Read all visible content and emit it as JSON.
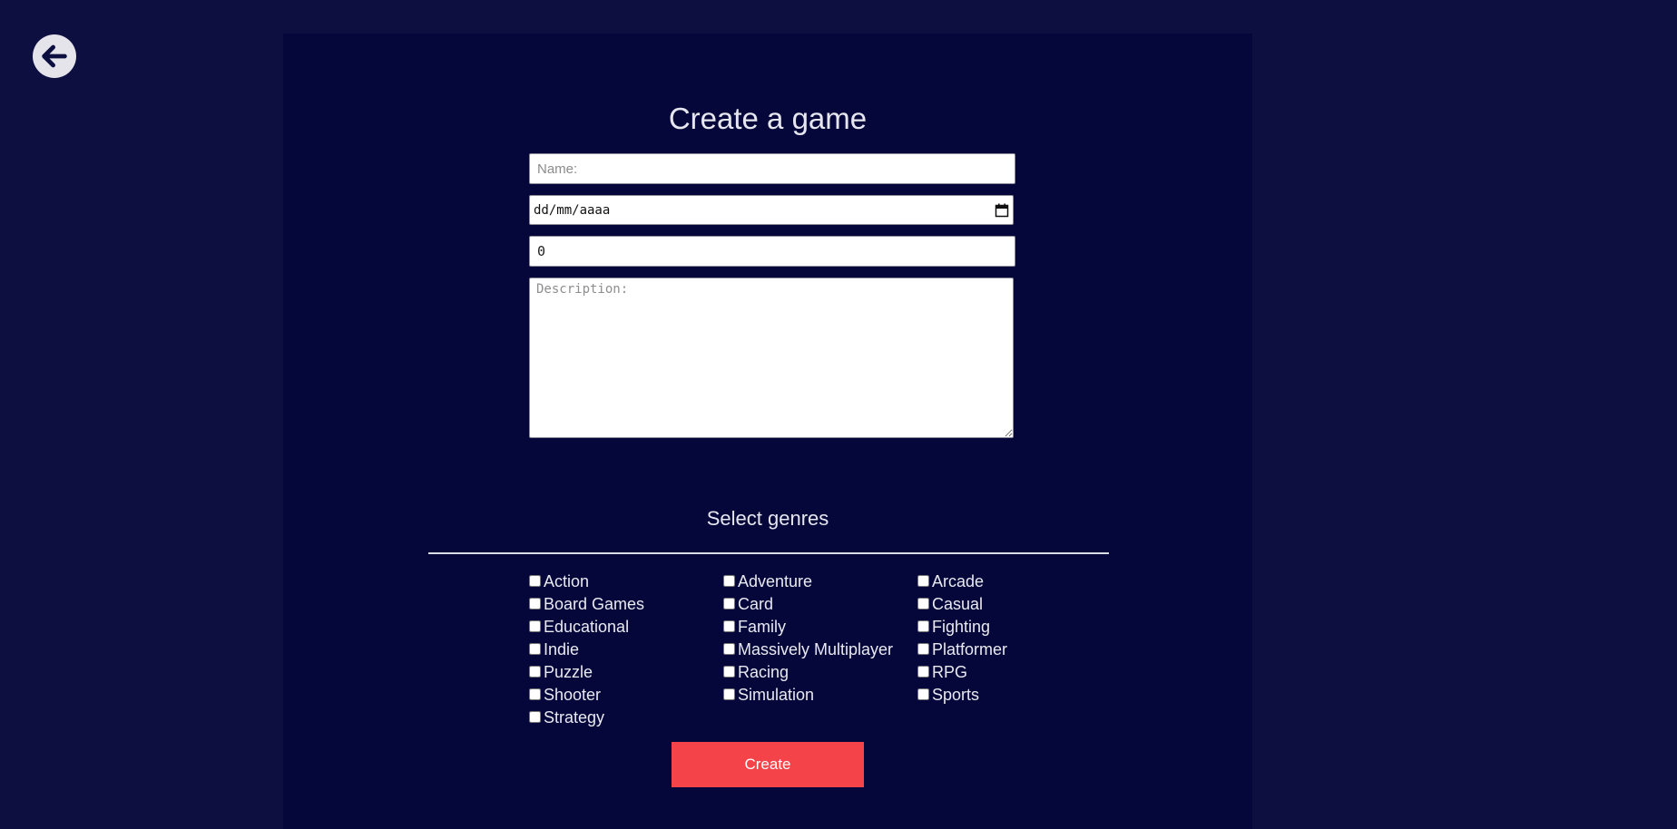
{
  "back": {
    "icon": "arrow-left-icon"
  },
  "form": {
    "title": "Create a game",
    "name_placeholder": "Name:",
    "date_value": "dd/mm/aaaa",
    "date_icon": "calendar-icon",
    "rating_value": "0",
    "description_placeholder": "Description:"
  },
  "genres": {
    "title": "Select genres",
    "items": [
      "Action",
      "Adventure",
      "Arcade",
      "Board Games",
      "Card",
      "Casual",
      "Educational",
      "Family",
      "Fighting",
      "Indie",
      "Massively Multiplayer",
      "Platformer",
      "Puzzle",
      "Racing",
      "RPG",
      "Shooter",
      "Simulation",
      "Sports",
      "Strategy"
    ]
  },
  "actions": {
    "create_label": "Create"
  },
  "colors": {
    "page_background": "#0c0f3f",
    "panel_background": "#05073a",
    "accent": "#f5434a",
    "text": "#e6e6ef"
  }
}
